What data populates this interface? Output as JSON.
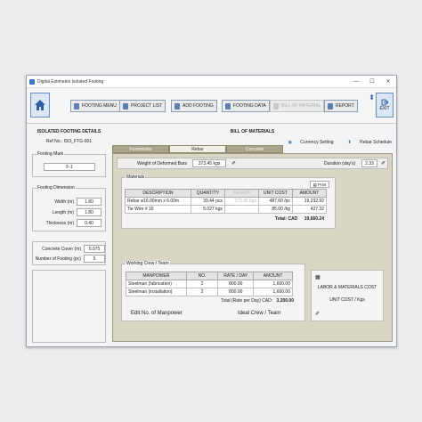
{
  "window": {
    "title": "Digital Estimates Isolated Footing",
    "controls": [
      "—",
      "☐",
      "✕"
    ]
  },
  "toolbar": {
    "buttons": [
      "FOOTING MENU",
      "PROJECT LIST",
      "ADD FOOTING",
      "FOOTING DATA",
      "BILL OF MATERIAL",
      "REPORT"
    ],
    "exit_label": "EXIT"
  },
  "left": {
    "header": "ISOLATED FOOTING DETAILS",
    "ref": "Ref No.: ISO_FTG-001",
    "footing_mark_label": "Footing Mark",
    "footing_mark": "F-1",
    "dimension_label": "Footing Dimension",
    "width_label": "Width (m)",
    "width": "1.80",
    "length_label": "Length (m)",
    "length": "1.80",
    "thickness_label": "Thickness (m)",
    "thickness": "0.40",
    "cover_label": "Concrete Cover (m)",
    "cover": "0.075",
    "count_label": "Number of Footing (pc)",
    "count": "5"
  },
  "main": {
    "header": "BILL OF MATERIALS",
    "currency_link": "Currency Setting",
    "rebar_link": "Rebar Schedule",
    "tabs": [
      "Formworks",
      "Rebar",
      "Concrete"
    ],
    "weight_label": "Weight of Deformed Bars",
    "weight": "373.45 kgs",
    "duration_label": "Duration (day's)",
    "duration": "2.33",
    "materials_label": "Materials",
    "print_label": "Print",
    "mat_headers": [
      "DESCRIPTION",
      "QUANTITY",
      "WEIGHT",
      "UNIT COST",
      "AMOUNT"
    ],
    "mat_rows": [
      [
        "Rebar ø16.00mm x 6.00m",
        "39.44 pcs",
        "373.45 kgs",
        "487.60 /pc",
        "19,232.92"
      ],
      [
        "Tie Wire # 16",
        "5.027 kgs",
        "",
        "85.00 /kg",
        "427.32"
      ]
    ],
    "mat_total_label": "Total: CAD",
    "mat_total": "19,660.24",
    "crew_label": "Working Crew / Team",
    "crew_headers": [
      "MANPOWER",
      "NO.",
      "RATE / DAY",
      "AMOUNT"
    ],
    "crew_rows": [
      [
        "Steelman (fabrication)",
        "2",
        "800.00",
        "1,600.00"
      ],
      [
        "Steelman (installation)",
        "2",
        "800.00",
        "1,600.00"
      ]
    ],
    "crew_total_label": "Total (Rate per Day) CAD:",
    "crew_total": "3,200.00",
    "edit_manpower": "Edit No. of Manpower",
    "ideal_crew": "Ideal Crew / Team",
    "side_title": "LABOR & MATERIALS COST",
    "side_sub": "UNIT COST / Kgs"
  }
}
